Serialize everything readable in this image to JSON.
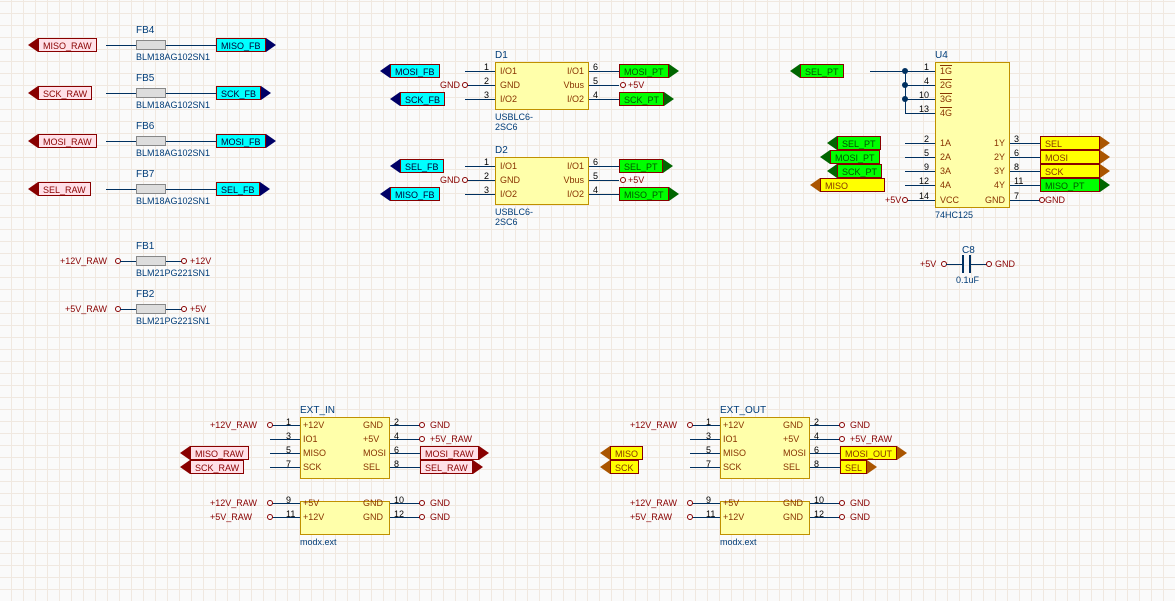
{
  "ferrites": {
    "fb4": {
      "ref": "FB4",
      "part": "BLM18AG102SN1",
      "in": "MISO_RAW",
      "out": "MISO_FB"
    },
    "fb5": {
      "ref": "FB5",
      "part": "BLM18AG102SN1",
      "in": "SCK_RAW",
      "out": "SCK_FB"
    },
    "fb6": {
      "ref": "FB6",
      "part": "BLM18AG102SN1",
      "in": "MOSI_RAW",
      "out": "MOSI_FB"
    },
    "fb7": {
      "ref": "FB7",
      "part": "BLM18AG102SN1",
      "in": "SEL_RAW",
      "out": "SEL_FB"
    },
    "fb1": {
      "ref": "FB1",
      "part": "BLM21PG221SN1",
      "in": "+12V_RAW",
      "out": "+12V"
    },
    "fb2": {
      "ref": "FB2",
      "part": "BLM21PG221SN1",
      "in": "+5V_RAW",
      "out": "+5V"
    }
  },
  "d1": {
    "ref": "D1",
    "part": "USBLC6-2SC6",
    "pins": {
      "1": "I/O1",
      "2": "GND",
      "3": "I/O2",
      "4": "I/O2",
      "5": "Vbus",
      "6": "I/O1"
    },
    "nets": {
      "p1": "MOSI_FB",
      "p2": "GND",
      "p3": "SCK_FB",
      "p6": "MOSI_PT",
      "p5": "+5V",
      "p4": "SCK_PT"
    }
  },
  "d2": {
    "ref": "D2",
    "part": "USBLC6-2SC6",
    "pins": {
      "1": "I/O1",
      "2": "GND",
      "3": "I/O2",
      "4": "I/O2",
      "5": "Vbus",
      "6": "I/O1"
    },
    "nets": {
      "p1": "SEL_FB",
      "p2": "GND",
      "p3": "MISO_FB",
      "p6": "SEL_PT",
      "p5": "+5V",
      "p4": "MISO_PT"
    }
  },
  "u4": {
    "ref": "U4",
    "part": "74HC125",
    "pins": {
      "1": "1G",
      "4": "2G",
      "10": "3G",
      "13": "4G",
      "2": "1A",
      "5": "2A",
      "9": "3A",
      "12": "4A",
      "3": "1Y",
      "6": "2Y",
      "8": "3Y",
      "11": "4Y",
      "14": "VCC",
      "7": "GND"
    },
    "nets": {
      "g": "SEL_PT",
      "a1": "SEL_PT",
      "a2": "MOSI_PT",
      "a3": "SCK_PT",
      "a4": "MISO",
      "y1": "SEL",
      "y2": "MOSI",
      "y3": "SCK",
      "y4": "MISO_PT",
      "vcc": "+5V",
      "gnd": "GND"
    }
  },
  "c8": {
    "ref": "C8",
    "value": "0.1uF",
    "left": "+5V",
    "right": "GND"
  },
  "ext_in": {
    "ref": "EXT_IN",
    "part": "modx.ext",
    "rows": [
      {
        "l": "+12V",
        "ln": "1",
        "r": "GND",
        "rn": "2",
        "lnet": "+12V_RAW",
        "rnet": "GND"
      },
      {
        "l": "IO1",
        "ln": "3",
        "r": "+5V",
        "rn": "4",
        "lnet": "",
        "rnet": "+5V_RAW"
      },
      {
        "l": "MISO",
        "ln": "5",
        "r": "MOSI",
        "rn": "6",
        "lnet": "MISO_RAW",
        "rnet": "MOSI_RAW"
      },
      {
        "l": "SCK",
        "ln": "7",
        "r": "SEL",
        "rn": "8",
        "lnet": "SCK_RAW",
        "rnet": "SEL_RAW"
      },
      {
        "l": "+5V",
        "ln": "9",
        "r": "GND",
        "rn": "10",
        "lnet": "+12V_RAW",
        "rnet": "GND"
      },
      {
        "l": "+12V",
        "ln": "11",
        "r": "GND",
        "rn": "12",
        "lnet": "+5V_RAW",
        "rnet": "GND"
      }
    ]
  },
  "ext_out": {
    "ref": "EXT_OUT",
    "part": "modx.ext",
    "rows": [
      {
        "l": "+12V",
        "ln": "1",
        "r": "GND",
        "rn": "2",
        "lnet": "+12V_RAW",
        "rnet": "GND"
      },
      {
        "l": "IO1",
        "ln": "3",
        "r": "+5V",
        "rn": "4",
        "lnet": "",
        "rnet": "+5V_RAW"
      },
      {
        "l": "MISO",
        "ln": "5",
        "r": "MOSI",
        "rn": "6",
        "lnet": "MISO",
        "rnet": "MOSI_OUT"
      },
      {
        "l": "SCK",
        "ln": "7",
        "r": "SEL",
        "rn": "8",
        "lnet": "SCK",
        "rnet": "SEL"
      },
      {
        "l": "+5V",
        "ln": "9",
        "r": "GND",
        "rn": "10",
        "lnet": "+12V_RAW",
        "rnet": "GND"
      },
      {
        "l": "+12V",
        "ln": "11",
        "r": "GND",
        "rn": "12",
        "lnet": "+5V_RAW",
        "rnet": "GND"
      }
    ]
  }
}
